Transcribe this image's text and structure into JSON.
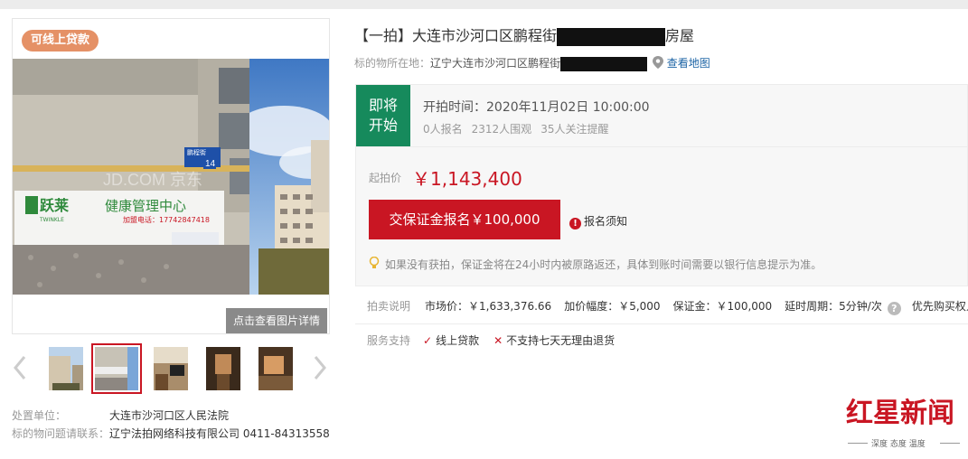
{
  "gallery": {
    "loan_tag": "可线上贷款",
    "photo_watermark": "JD.COM 京东",
    "shop_sign_brand": "跃莱",
    "shop_sign_sub": "TWINKLE",
    "shop_sign_name": "健康管理中心",
    "shop_sign_phone": "加盟电话：17742847418",
    "street_sign": "鹏程街",
    "street_sign_no": "14",
    "detail_button": "点击查看图片详情",
    "thumb_count": 5,
    "active_thumb_index": 1
  },
  "org_info": [
    {
      "label": "处置单位：",
      "value": "大连市沙河口区人民法院"
    },
    {
      "label": "标的物问题请联系：",
      "value": "辽宁法拍网络科技有限公司 0411-84313558"
    }
  ],
  "listing": {
    "title_prefix": "【一拍】大连市沙河口区鹏程街",
    "title_suffix": "房屋",
    "location_label": "标的物所在地：",
    "location_prefix": "辽宁大连市沙河口区鹏程街",
    "map_link": "查看地图"
  },
  "status": {
    "line1": "即将",
    "line2": "开始",
    "start_time": "开拍时间：2020年11月02日 10:00:00",
    "signups": "0人报名",
    "views": "2312人围观",
    "followers": "35人关注提醒"
  },
  "price": {
    "label": "起拍价",
    "value": "￥1,143,400",
    "deposit_button": "交保证金报名￥100,000",
    "notice": "报名须知",
    "tip": "如果没有获拍，保证金将在24小时内被原路返还，具体到账时间需要以银行信息提示为准。"
  },
  "auction": {
    "label": "拍卖说明",
    "market_price": "市场价：￥1,633,376.66",
    "increment": "加价幅度：￥5,000",
    "deposit": "保证金：￥100,000",
    "delay": "延时周期：5分钟/次",
    "priority": "优先购买权人"
  },
  "services": {
    "label": "服务支持",
    "online_loan": "线上贷款",
    "no_return": "不支持七天无理由退货"
  },
  "brand_watermark": {
    "title": "红星新闻",
    "sub": "深度 态度 温度"
  },
  "colors": {
    "accent_red": "#c91623",
    "status_green": "#168a5c",
    "loan_tag": "#e59166",
    "link_blue": "#1d64a5"
  }
}
